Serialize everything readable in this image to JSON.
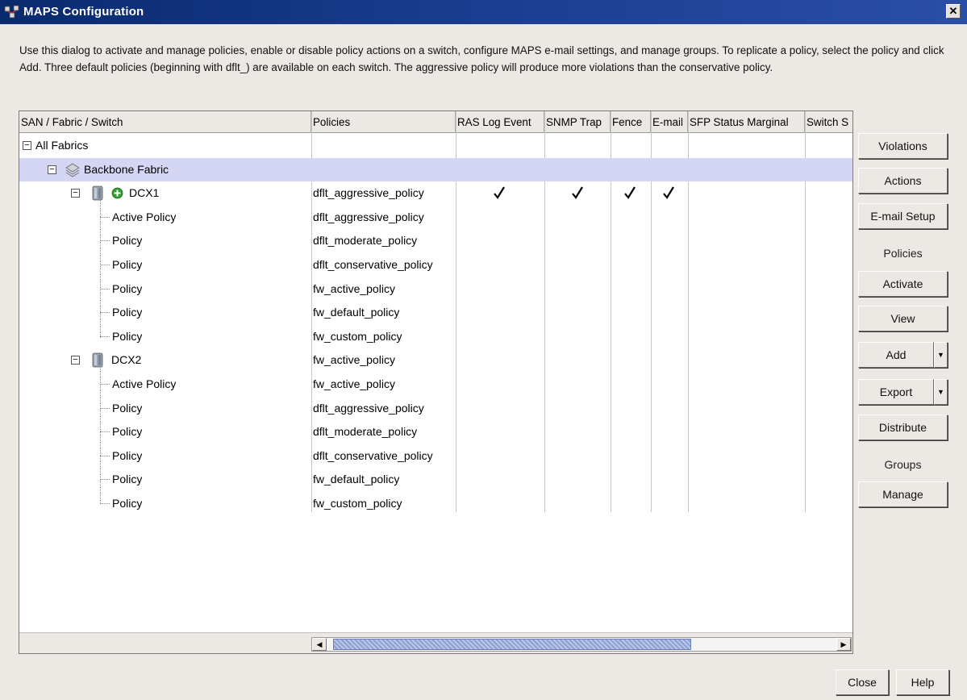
{
  "window": {
    "title": "MAPS Configuration"
  },
  "description": "Use this dialog to activate and manage policies, enable or disable policy actions on a switch, configure MAPS e-mail settings, and manage groups. To replicate a policy, select the policy and click Add. Three default policies (beginning with dflt_) are available on each switch. The aggressive policy will produce more violations than the conservative policy.",
  "table": {
    "columns": [
      "SAN / Fabric / Switch",
      "Policies",
      "RAS Log Event",
      "SNMP Trap",
      "Fence",
      "E-mail",
      "SFP Status Marginal",
      "Switch S"
    ],
    "rows": [
      {
        "name": "All Fabrics",
        "policy": ""
      },
      {
        "name": "Backbone Fabric",
        "policy": ""
      },
      {
        "name": "DCX1",
        "policy": "dflt_aggressive_policy"
      },
      {
        "name": "Active Policy",
        "policy": "dflt_aggressive_policy"
      },
      {
        "name": "Policy",
        "policy": "dflt_moderate_policy"
      },
      {
        "name": "Policy",
        "policy": "dflt_conservative_policy"
      },
      {
        "name": "Policy",
        "policy": "fw_active_policy"
      },
      {
        "name": "Policy",
        "policy": "fw_default_policy"
      },
      {
        "name": "Policy",
        "policy": "fw_custom_policy"
      },
      {
        "name": "DCX2",
        "policy": "fw_active_policy"
      },
      {
        "name": "Active Policy",
        "policy": "fw_active_policy"
      },
      {
        "name": "Policy",
        "policy": "dflt_aggressive_policy"
      },
      {
        "name": "Policy",
        "policy": "dflt_moderate_policy"
      },
      {
        "name": "Policy",
        "policy": "dflt_conservative_policy"
      },
      {
        "name": "Policy",
        "policy": "fw_default_policy"
      },
      {
        "name": "Policy",
        "policy": "fw_custom_policy"
      }
    ],
    "dcx1_actions_checked": [
      "RAS Log Event",
      "SNMP Trap",
      "Fence",
      "E-mail"
    ]
  },
  "side_buttons": {
    "violations": "Violations",
    "actions": "Actions",
    "email_setup": "E-mail Setup",
    "policies_label": "Policies",
    "activate": "Activate",
    "view": "View",
    "add": "Add",
    "export": "Export",
    "distribute": "Distribute",
    "groups_label": "Groups",
    "manage": "Manage"
  },
  "footer": {
    "close": "Close",
    "help": "Help"
  },
  "icons": [
    "maps-app-icon",
    "close-window-icon",
    "fabric-icon",
    "switch-icon",
    "status-ok-icon",
    "checkmark-icon",
    "dropdown-arrow-icon",
    "scroll-left-icon",
    "scroll-right-icon"
  ],
  "colors": {
    "titlebar": "#0a2a6e",
    "selection": "#d4d6f4",
    "status_ok": "#2e9e2e"
  }
}
